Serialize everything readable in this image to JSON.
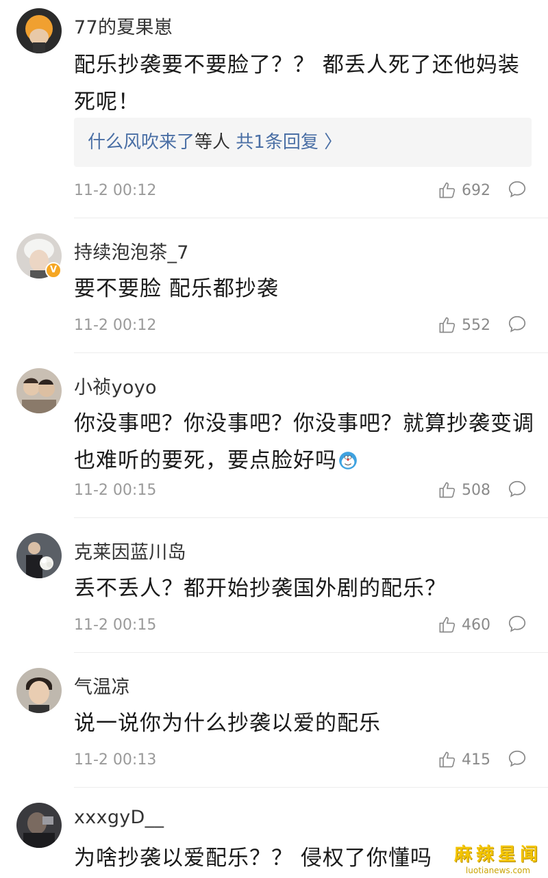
{
  "comments": [
    {
      "username": "77的夏果崽",
      "content": "配乐抄袭要不要脸了？？ 都丢人死了还他妈装死呢！",
      "reply": {
        "name": "什么风吹来了",
        "mid": "等人",
        "count": "共1条回复 〉"
      },
      "time": "11-2 00:12",
      "likes": "692",
      "avatar": "orange-hair-avatar"
    },
    {
      "username": "持续泡泡茶_7",
      "content": "要不要脸 配乐都抄袭",
      "time": "11-2 00:12",
      "likes": "552",
      "avatar": "white-hair-avatar",
      "verified": true,
      "badge": "V"
    },
    {
      "username": "小祯yoyo",
      "content": "你没事吧？你没事吧？你没事吧？就算抄袭变调也难听的要死，要点脸好吗",
      "emoji": "doraemon-emoji",
      "time": "11-2 00:15",
      "likes": "508",
      "avatar": "couple-avatar"
    },
    {
      "username": "克莱因蓝川岛",
      "content": "丢不丢人？都开始抄袭国外剧的配乐？",
      "time": "11-2 00:15",
      "likes": "460",
      "avatar": "bouquet-avatar"
    },
    {
      "username": "气温凉",
      "content": "说一说你为什么抄袭以爱的配乐",
      "time": "11-2 00:13",
      "likes": "415",
      "avatar": "boy-avatar"
    },
    {
      "username": "xxxgyD__",
      "content": "为啥抄袭以爱配乐？？ 侵权了你懂吗",
      "avatar": "dark-photo-avatar"
    }
  ],
  "watermark": {
    "main": "麻辣星闻",
    "sub": "luotianews.com"
  },
  "colors": {
    "link": "#4a6fa5",
    "meta": "#9a9a9a",
    "badge": "#f5a623",
    "reply_bg": "#f5f5f5"
  }
}
